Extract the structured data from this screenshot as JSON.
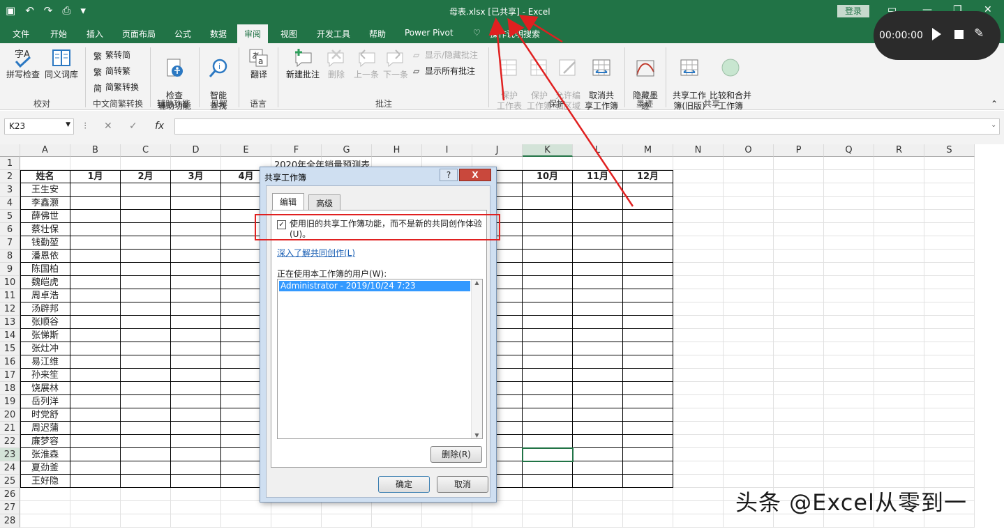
{
  "title_bar": {
    "title": "母表.xlsx  [已共享]  -  Excel",
    "login": "登录"
  },
  "menu_tabs": [
    "文件",
    "开始",
    "插入",
    "页面布局",
    "公式",
    "数据",
    "审阅",
    "视图",
    "开发工具",
    "帮助",
    "Power Pivot",
    "操作说明搜索"
  ],
  "recorder": {
    "time": "00:00:00"
  },
  "ribbon": {
    "spell": "拼写检查",
    "thesaurus": "同义词库",
    "proofing": "校对",
    "to_simplified": "繁转简",
    "to_traditional": "简转繁",
    "convert": "简繁转换",
    "chinese_group": "中文简繁转换",
    "accessibility_check": "检查\n辅助功能",
    "accessibility": "辅助功能",
    "smart_lookup": "智能\n查找",
    "insights": "见解",
    "translate": "翻译",
    "language": "语言",
    "new_comment": "新建批注",
    "delete": "删除",
    "prev": "上一条",
    "next": "下一条",
    "show_hide": "显示/隐藏批注",
    "show_all": "显示所有批注",
    "comments": "批注",
    "protect_sheet": "保护\n工作表",
    "protect_book": "保护\n工作簿",
    "allow_edit": "允许编\n辑区域",
    "unshare": "取消共\n享工作簿",
    "protect": "保护",
    "hide_ink": "隐藏墨\n迹",
    "ink": "墨迹",
    "share_legacy": "共享工作\n簿(旧版)",
    "compare_merge": "比较和合并\n工作簿",
    "share": "共享"
  },
  "formula_bar": {
    "name_box": "K23",
    "fx": "fx",
    "value": ""
  },
  "sheet": {
    "columns": [
      "A",
      "B",
      "C",
      "D",
      "E",
      "F",
      "G",
      "H",
      "I",
      "J",
      "K",
      "L",
      "M",
      "N",
      "O",
      "P",
      "Q",
      "R",
      "S"
    ],
    "rows": [
      "1",
      "2",
      "3",
      "4",
      "5",
      "6",
      "7",
      "8",
      "9",
      "10",
      "11",
      "12",
      "13",
      "14",
      "15",
      "16",
      "17",
      "18",
      "19",
      "20",
      "21",
      "22",
      "23",
      "24",
      "25",
      "26",
      "27",
      "28"
    ],
    "title": "2020年全年销量预测表",
    "header_cells": [
      "姓名",
      "1月",
      "2月",
      "3月",
      "4月",
      "",
      "",
      "",
      "",
      "",
      "10月",
      "11月",
      "12月"
    ],
    "names": [
      "王生安",
      "李鑫灏",
      "薛佛世",
      "蔡壮保",
      "钱勤堃",
      "潘恩依",
      "陈国柏",
      "魏皑虎",
      "周卓浩",
      "汤辟邦",
      "张顺谷",
      "张悌斯",
      "张灶冲",
      "易江维",
      "孙来笙",
      "饶展林",
      "岳列洋",
      "时党舒",
      "周迟蒲",
      "廉梦容",
      "张淮森",
      "夏劲釜",
      "王好隐"
    ],
    "selected": "K23"
  },
  "dialog": {
    "title": "共享工作簿",
    "help": "?",
    "close": "X",
    "tab_edit": "编辑",
    "tab_advanced": "高级",
    "checkbox_label": "使用旧的共享工作簿功能，而不是新的共同创作体验(U)。",
    "checkbox_checked": "✓",
    "learn_link": "深入了解共同创作(L)",
    "users_label": "正在使用本工作簿的用户(W):",
    "users": [
      "Administrator - 2019/10/24 7:23"
    ],
    "remove_btn": "删除(R)",
    "ok_btn": "确定",
    "cancel_btn": "取消"
  },
  "watermark": "头条 @Excel从零到一",
  "colors": {
    "excel_green": "#217346",
    "annotation_red": "#e02020"
  }
}
